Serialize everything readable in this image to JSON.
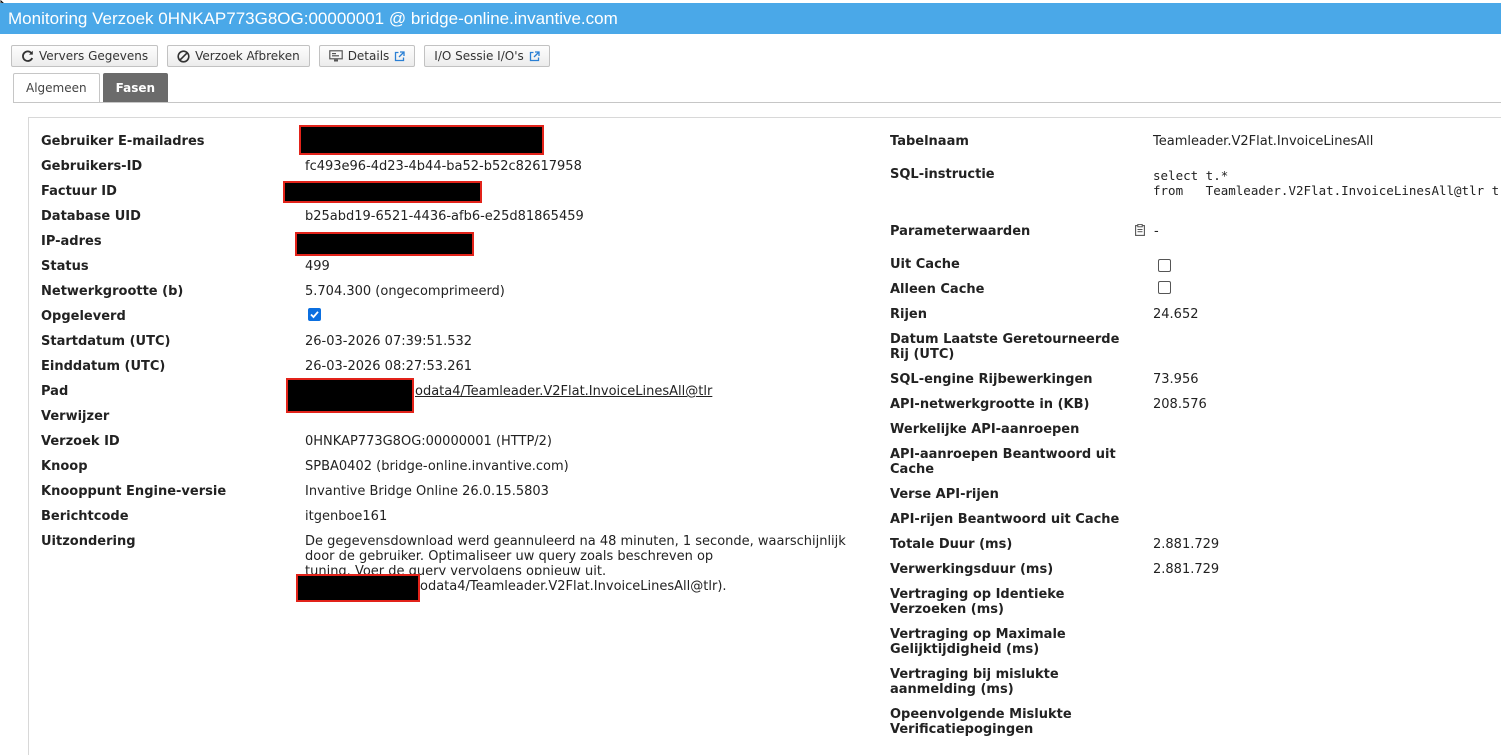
{
  "window": {
    "title": "Monitoring Verzoek 0HNKAP773G8OG:00000001 @ bridge-online.invantive.com"
  },
  "toolbar": {
    "refresh_label": "Ververs Gegevens",
    "abort_label": "Verzoek Afbreken",
    "details_label": "Details",
    "io_label": "I/O Sessie I/O's"
  },
  "tabs": {
    "general": "Algemeen",
    "phases": "Fasen"
  },
  "left": {
    "email_label": "Gebruiker E-mailadres",
    "user_id_label": "Gebruikers-ID",
    "user_id_value": "fc493e96-4d23-4b44-ba52-b52c82617958",
    "invoice_id_label": "Factuur ID",
    "db_uid_label": "Database UID",
    "db_uid_value": "b25abd19-6521-4436-afb6-e25d81865459",
    "ip_label": "IP-adres",
    "status_label": "Status",
    "status_value": "499",
    "net_size_label": "Netwerkgrootte (b)",
    "net_size_value": "5.704.300 (ongecomprimeerd)",
    "delivered_label": "Opgeleverd",
    "start_label": "Startdatum (UTC)",
    "start_value": "26-03-2026 07:39:51.532",
    "end_label": "Einddatum (UTC)",
    "end_value": "26-03-2026 08:27:53.261",
    "path_label": "Pad",
    "path_value": "odata4/Teamleader.V2Flat.InvoiceLinesAll@tlr",
    "referrer_label": "Verwijzer",
    "request_id_label": "Verzoek ID",
    "request_id_value": "0HNKAP773G8OG:00000001 (HTTP/2)",
    "node_label": "Knoop",
    "node_value": "SPBA0402 (bridge-online.invantive.com)",
    "engine_label": "Knooppunt Engine-versie",
    "engine_value": "Invantive Bridge Online 26.0.15.5803",
    "msgcode_label": "Berichtcode",
    "msgcode_value": "itgenboe161",
    "exception_label": "Uitzondering",
    "exception_value": "De gegevensdownload werd geannuleerd na 48 minuten, 1 seconde, waarschijnlijk door de gebruiker. Optimaliseer uw query zoals beschreven op https://go.invantive.com/nl/power-bi-tuning. Voer de query vervolgens opnieuw uit.",
    "exception_tail": "odata4/Teamleader.V2Flat.InvoiceLinesAll@tlr)."
  },
  "right": {
    "table_label": "Tabelnaam",
    "table_value": "Teamleader.V2Flat.InvoiceLinesAll",
    "sql_label": "SQL-instructie",
    "sql_line1": "select t.*",
    "sql_line2": "from   Teamleader.V2Flat.InvoiceLinesAll@tlr t",
    "params_label": "Parameterwaarden",
    "params_value": "-",
    "from_cache_label": "Uit Cache",
    "only_cache_label": "Alleen Cache",
    "rows_label": "Rijen",
    "rows_value": "24.652",
    "last_row_label": "Datum Laatste Geretourneerde Rij (UTC)",
    "sql_rows_label": "SQL-engine Rijbewerkingen",
    "sql_rows_value": "73.956",
    "api_net_label": "API-netwerkgrootte in (KB)",
    "api_net_value": "208.576",
    "api_calls_label": "Werkelijke API-aanroepen",
    "api_cache_calls_label": "API-aanroepen Beantwoord uit Cache",
    "fresh_rows_label": "Verse API-rijen",
    "cache_rows_label": "API-rijen Beantwoord uit Cache",
    "total_dur_label": "Totale Duur (ms)",
    "total_dur_value": "2.881.729",
    "proc_dur_label": "Verwerkingsduur (ms)",
    "proc_dur_value": "2.881.729",
    "delay_ident_label": "Vertraging op Identieke Verzoeken (ms)",
    "delay_max_label": "Vertraging op Maximale Gelijktijdigheid (ms)",
    "delay_login_label": "Vertraging bij mislukte aanmelding (ms)",
    "failed_verif_label": "Opeenvolgende Mislukte Verificatiepogingen"
  },
  "colors": {
    "titlebar": "#4aa8e8",
    "checkbox_checked": "#0b6fe0",
    "redaction_border": "#e2231a"
  }
}
